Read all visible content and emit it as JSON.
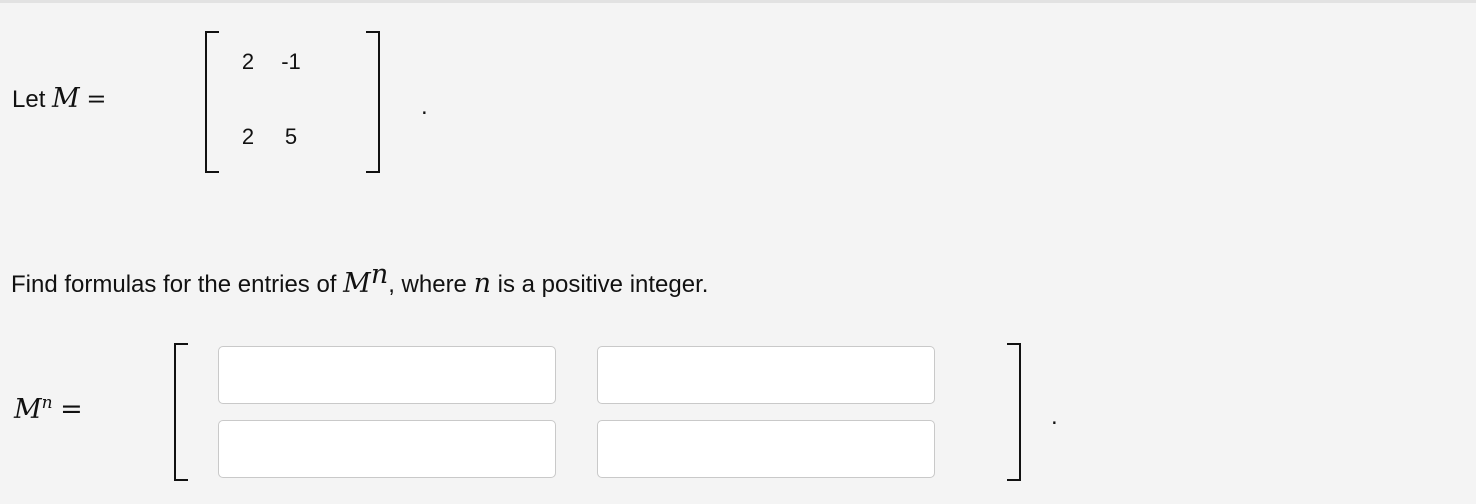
{
  "definition": {
    "let_word": "Let",
    "symbol": "M",
    "equals": "=",
    "matrix": [
      [
        "2",
        "-1"
      ],
      [
        "2",
        "5"
      ]
    ],
    "end_period": "."
  },
  "prompt": {
    "before": "Find formulas for the entries of ",
    "symbol": "M",
    "exponent": "n",
    "middle": ", where ",
    "variable": "n",
    "after": " is a positive integer."
  },
  "answer": {
    "symbol": "M",
    "exponent": "n",
    "equals": "=",
    "inputs": [
      {
        "value": "",
        "placeholder": ""
      },
      {
        "value": "",
        "placeholder": ""
      },
      {
        "value": "",
        "placeholder": ""
      },
      {
        "value": "",
        "placeholder": ""
      }
    ],
    "end_period": "."
  }
}
